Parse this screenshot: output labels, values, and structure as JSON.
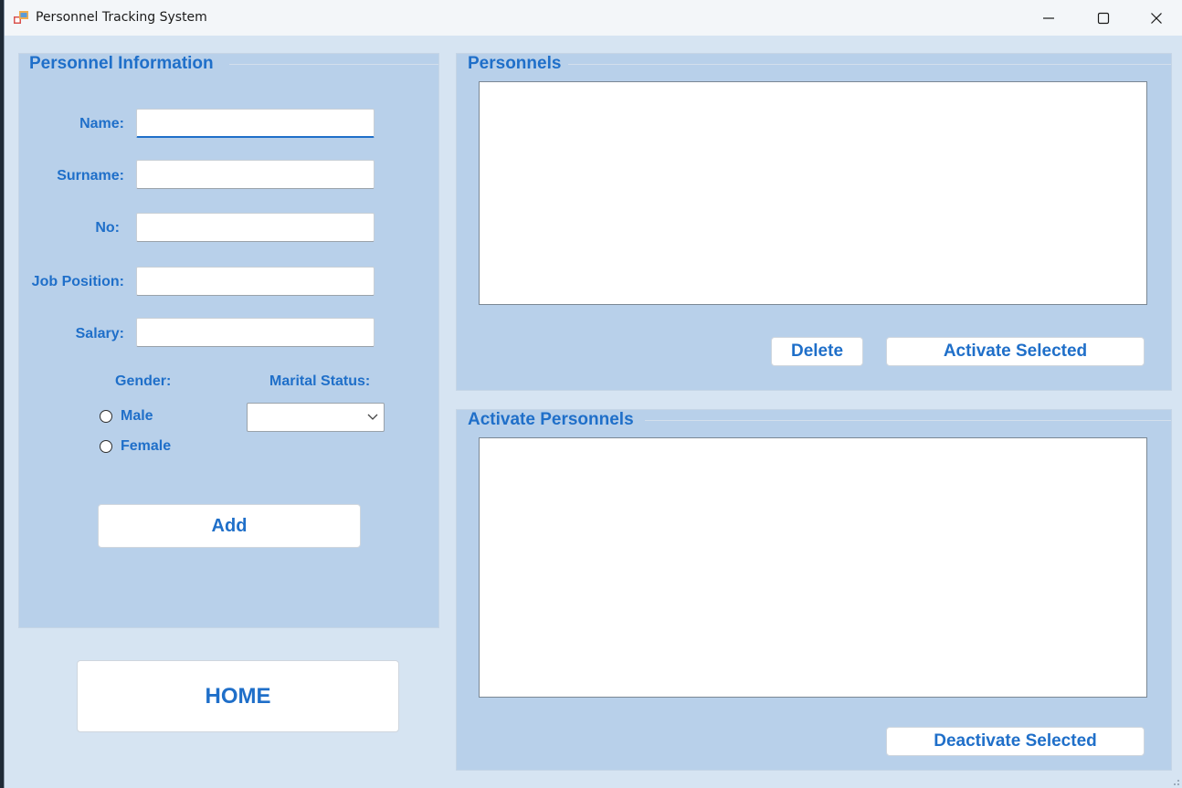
{
  "window": {
    "title": "Personnel Tracking System",
    "controls": {
      "minimize": "minimize-icon",
      "maximize": "maximize-icon",
      "close": "close-icon"
    }
  },
  "personnel_info": {
    "title": "Personnel Information",
    "fields": {
      "name": {
        "label": "Name:",
        "value": ""
      },
      "surname": {
        "label": "Surname:",
        "value": ""
      },
      "no": {
        "label": "No:",
        "value": ""
      },
      "job_position": {
        "label": "Job Position:",
        "value": ""
      },
      "salary": {
        "label": "Salary:",
        "value": ""
      }
    },
    "gender": {
      "label": "Gender:",
      "options": [
        "Male",
        "Female"
      ]
    },
    "marital_status": {
      "label": "Marital Status:",
      "value": ""
    },
    "add_button": "Add"
  },
  "home_button": "HOME",
  "personnels": {
    "title": "Personnels",
    "items": [],
    "delete_button": "Delete",
    "activate_button": "Activate Selected"
  },
  "active_personnels": {
    "title": "Activate Personnels",
    "items": [],
    "deactivate_button": "Deactivate Selected"
  },
  "colors": {
    "accent": "#1f6fc9",
    "window_bg": "#d6e4f2",
    "panel_bg": "#b8d0ea",
    "titlebar_bg": "#f3f6f9"
  }
}
